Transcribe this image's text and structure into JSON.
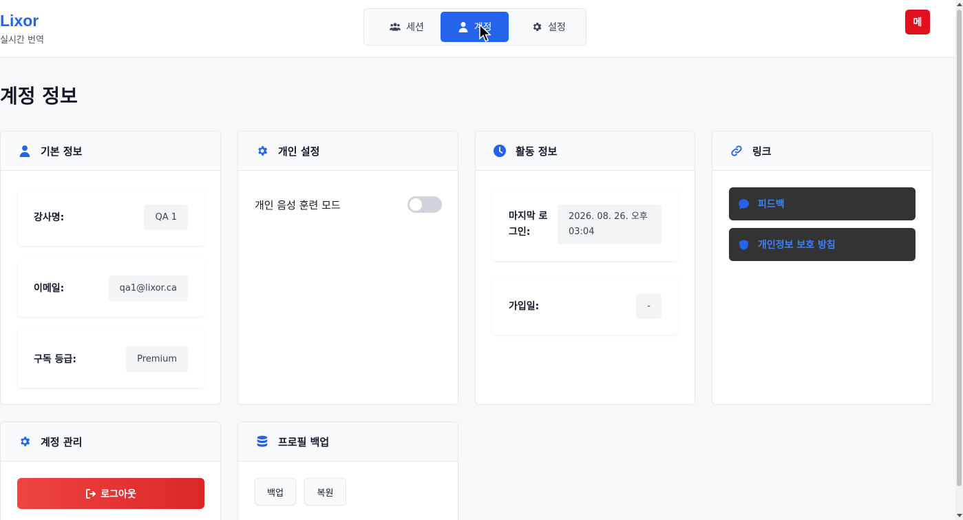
{
  "brand": {
    "name": "Lixor",
    "subtitle": "실시간 번역"
  },
  "nav": {
    "tabs": [
      {
        "label": "세션",
        "icon": "users-icon"
      },
      {
        "label": "계정",
        "icon": "user-icon",
        "active": true
      },
      {
        "label": "설정",
        "icon": "gear-icon"
      }
    ]
  },
  "menu_button": {
    "label": "메",
    "color": "#e0101e"
  },
  "page": {
    "title": "계정 정보"
  },
  "basic_info": {
    "title": "기본 정보",
    "rows": [
      {
        "label": "강사명:",
        "value": "QA 1"
      },
      {
        "label": "이메일:",
        "value": "qa1@lixor.ca"
      },
      {
        "label": "구독 등급:",
        "value": "Premium"
      }
    ]
  },
  "personal_settings": {
    "title": "개인 설정",
    "voice_training": {
      "label": "개인 음성 훈련 모드",
      "enabled": false
    }
  },
  "activity": {
    "title": "활동 정보",
    "last_login": {
      "label_line1": "마지막 로",
      "label_line2": "그인:",
      "value_line1": "2026. 08. 26. 오후",
      "value_line2": "03:04"
    },
    "joined": {
      "label": "가입일:",
      "value": "-"
    }
  },
  "links": {
    "title": "링크",
    "items": [
      {
        "label": "피드백",
        "icon": "chat-bubble-icon"
      },
      {
        "label": "개인정보 보호 방침",
        "icon": "shield-icon"
      }
    ]
  },
  "account_management": {
    "title": "계정 관리",
    "logout_label": "로그아웃"
  },
  "profile_backup": {
    "title": "프로필 백업",
    "backup_label": "백업",
    "restore_label": "복원"
  },
  "colors": {
    "accent": "#2563eb",
    "danger": "#ef4444",
    "link_bg": "#333333"
  }
}
